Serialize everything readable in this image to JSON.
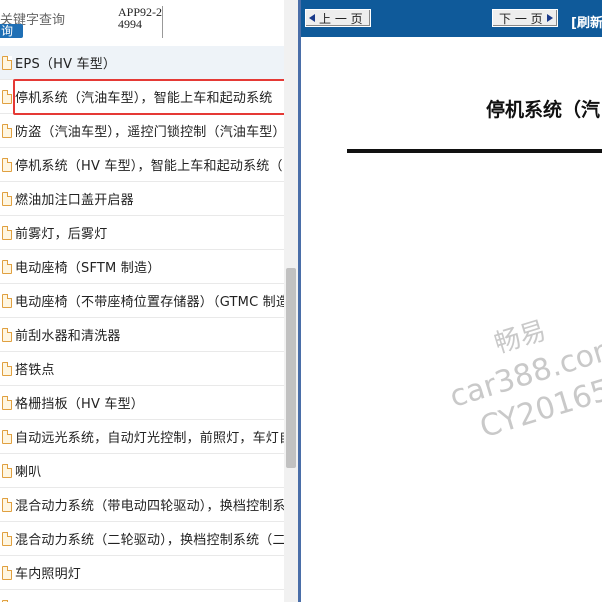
{
  "search": {
    "label": "关键字查询",
    "button_label": "询"
  },
  "app_info": "APP92-24994",
  "tree_items": [
    {
      "label": "EPS（HV 车型）"
    },
    {
      "label": "停机系统（汽油车型），智能上车和起动系统"
    },
    {
      "label": "防盗（汽油车型），遥控门锁控制（汽油车型）"
    },
    {
      "label": "停机系统（HV 车型），智能上车和起动系统（"
    },
    {
      "label": "燃油加注口盖开启器"
    },
    {
      "label": "前雾灯，后雾灯"
    },
    {
      "label": "电动座椅（SFTM 制造）"
    },
    {
      "label": "电动座椅（不带座椅位置存储器）（GTMC 制造"
    },
    {
      "label": "前刮水器和清洗器"
    },
    {
      "label": "搭铁点"
    },
    {
      "label": "格栅挡板（HV 车型）"
    },
    {
      "label": "自动远光系统，自动灯光控制，前照灯，车灯自"
    },
    {
      "label": "喇叭"
    },
    {
      "label": "混合动力系统（带电动四轮驱动），换档控制系"
    },
    {
      "label": "混合动力系统（二轮驱动），换档控制系统（二"
    },
    {
      "label": "车内照明灯"
    },
    {
      "label": "…"
    }
  ],
  "nav": {
    "prev_label": "上 一 页",
    "next_label": "下 一 页",
    "refresh_label": "[刷新"
  },
  "document": {
    "title": "停机系统（汽"
  },
  "watermark": {
    "line1": "畅易",
    "line2": "car388.com",
    "line3": "CY20165"
  },
  "colors": {
    "nav_bar": "#0f5a9a",
    "highlight_border": "#e53935",
    "search_button": "#1f6fb5"
  }
}
